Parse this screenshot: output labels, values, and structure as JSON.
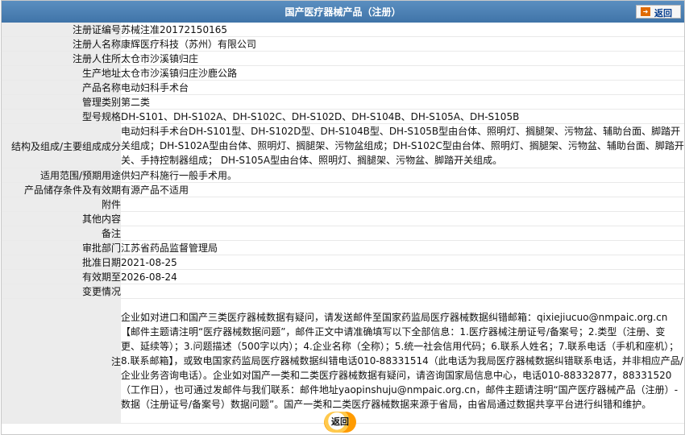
{
  "header": {
    "title": "国产医疗器械产品（注册）",
    "back_label": "返回",
    "back_icon": "arrow-right-icon"
  },
  "rows": [
    {
      "label": "注册证编号",
      "value": "苏械注准20172150165"
    },
    {
      "label": "注册人名称",
      "value": "康辉医疗科技（苏州）有限公司"
    },
    {
      "label": "注册人住所",
      "value": "太仓市沙溪镇归庄"
    },
    {
      "label": "生产地址",
      "value": "太仓市沙溪镇归庄沙鹿公路"
    },
    {
      "label": "产品名称",
      "value": "电动妇科手术台"
    },
    {
      "label": "管理类别",
      "value": "第二类"
    },
    {
      "label": "型号规格",
      "value": "DH-S101、DH-S102A、DH-S102C、DH-S102D、DH-S104B、DH-S105A、DH-S105B"
    },
    {
      "label": "结构及组成/主要组成成分",
      "value": "电动妇科手术台DH-S101型、DH-S102D型、DH-S104B型、DH-S105B型由台体、照明灯、搁腿架、污物盆、辅助台面、脚踏开关组成；DH-S102A型由台体、照明灯、搁腿架、污物盆组成；DH-S102C型由台体、照明灯、搁腿架、污物盆、辅助台面、脚踏开关、手持控制器组成； DH-S105A型由台体、照明灯、搁腿架、污物盆、脚踏开关组成。"
    },
    {
      "label": "适用范围/预期用途",
      "value": "供妇产科施行一般手术用。"
    },
    {
      "label": "产品储存条件及有效期",
      "value": "有源产品不适用"
    },
    {
      "label": "附件",
      "value": ""
    },
    {
      "label": "其他内容",
      "value": ""
    },
    {
      "label": "备注",
      "value": ""
    },
    {
      "label": "审批部门",
      "value": "江苏省药品监督管理局"
    },
    {
      "label": "批准日期",
      "value": "2021-08-25"
    },
    {
      "label": "有效期至",
      "value": "2026-08-24"
    },
    {
      "label": "变更情况",
      "value": ""
    }
  ],
  "note": {
    "label": "注",
    "text": "企业如对进口和国产三类医疗器械数据有疑问，请发送邮件至国家药监局医疗器械数据纠错邮箱：qixiejiucuo@nmpaic.org.cn【邮件主题请注明“医疗器械数据问题”，邮件正文中请准确填写以下全部信息：1.医疗器械注册证号/备案号；2.类型（注册、变更、延续等）；3.问题描述（500字以内）；4.企业名称（全称）；5.统一社会信用代码；6.联系人姓名；7.联系电话（手机和座机）；8.联系邮箱】，或致电国家药监局医疗器械数据纠错电话010-88331514（此电话为我局医疗器械数据纠错联系电话，并非相应产品/企业业务咨询电话）。企业如对国产一类和二类医疗器械数据有疑问，请咨询国家局信息中心，电话010-88332877，88331520（工作日），也可通过发邮件与我们联系：邮件地址yaopinshuju@nmpaic.org.cn，邮件主题请注明“国产医疗器械产品（注册）-数据（注册证号/备案号）数据问题”。国产一类和二类医疗器械数据来源于省局，由省局通过数据共享平台进行纠错和维护。"
  },
  "footer": {
    "back_label": "返回"
  }
}
